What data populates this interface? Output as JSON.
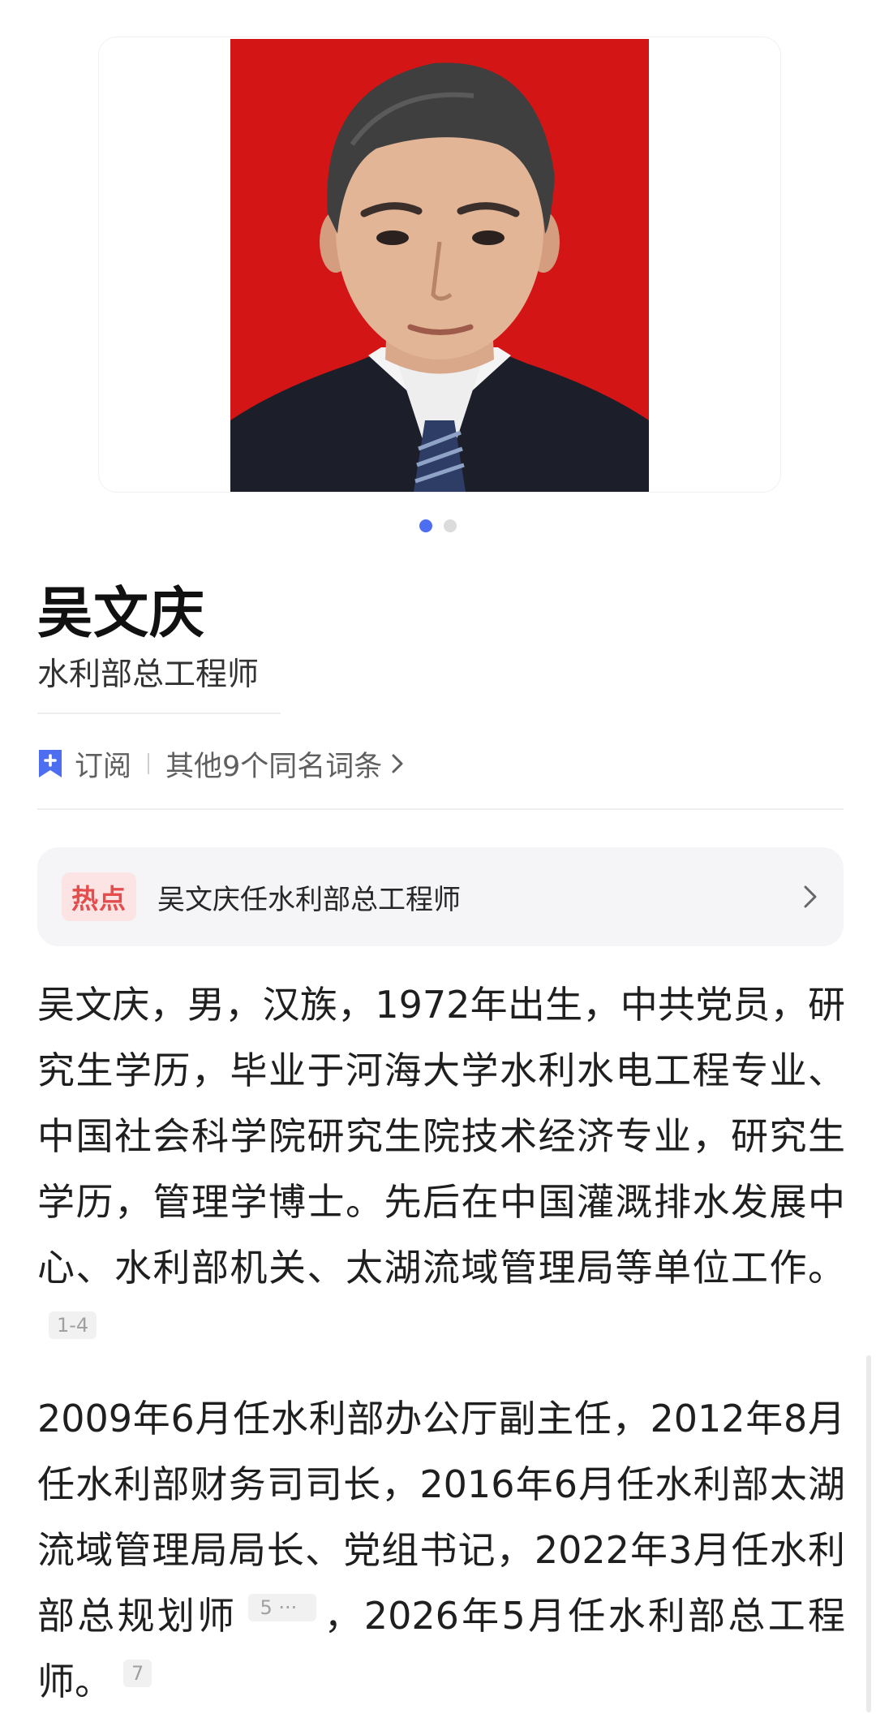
{
  "hero": {
    "image_alt": "吴文庆",
    "carousel_total": 2,
    "carousel_active": 1
  },
  "entry": {
    "name": "吴文庆",
    "subtitle": "水利部总工程师"
  },
  "actions": {
    "subscribe_label": "订阅",
    "homonyms_label": "其他9个同名词条"
  },
  "hot": {
    "badge": "热点",
    "headline": "吴文庆任水利部总工程师"
  },
  "paragraphs": {
    "p1_text": "吴文庆，男，汉族，1972年出生，中共党员，研究生学历，毕业于河海大学水利水电工程专业、中国社会科学院研究生院技术经济专业，研究生学历，管理学博士。先后在中国灌溉排水发展中心、水利部机关、太湖流域管理局等单位工作。",
    "p1_ref": "1-4",
    "p2_text_a": "2009年6月任水利部办公厅副主任，2012年8月任水利部财务司司长，2016年6月任水利部太湖流域管理局局长、党组书记，2022年3月任水利部总规划师",
    "p2_ref_a": "5 ···",
    "p2_text_b": "，2026年5月任水利部总工程师。",
    "p2_ref_b": "7"
  },
  "colors": {
    "accent": "#4e6ef2",
    "hot_badge_bg": "#fde4e4",
    "hot_badge_text": "#e44d4d",
    "portrait_bg": "#d41515"
  }
}
